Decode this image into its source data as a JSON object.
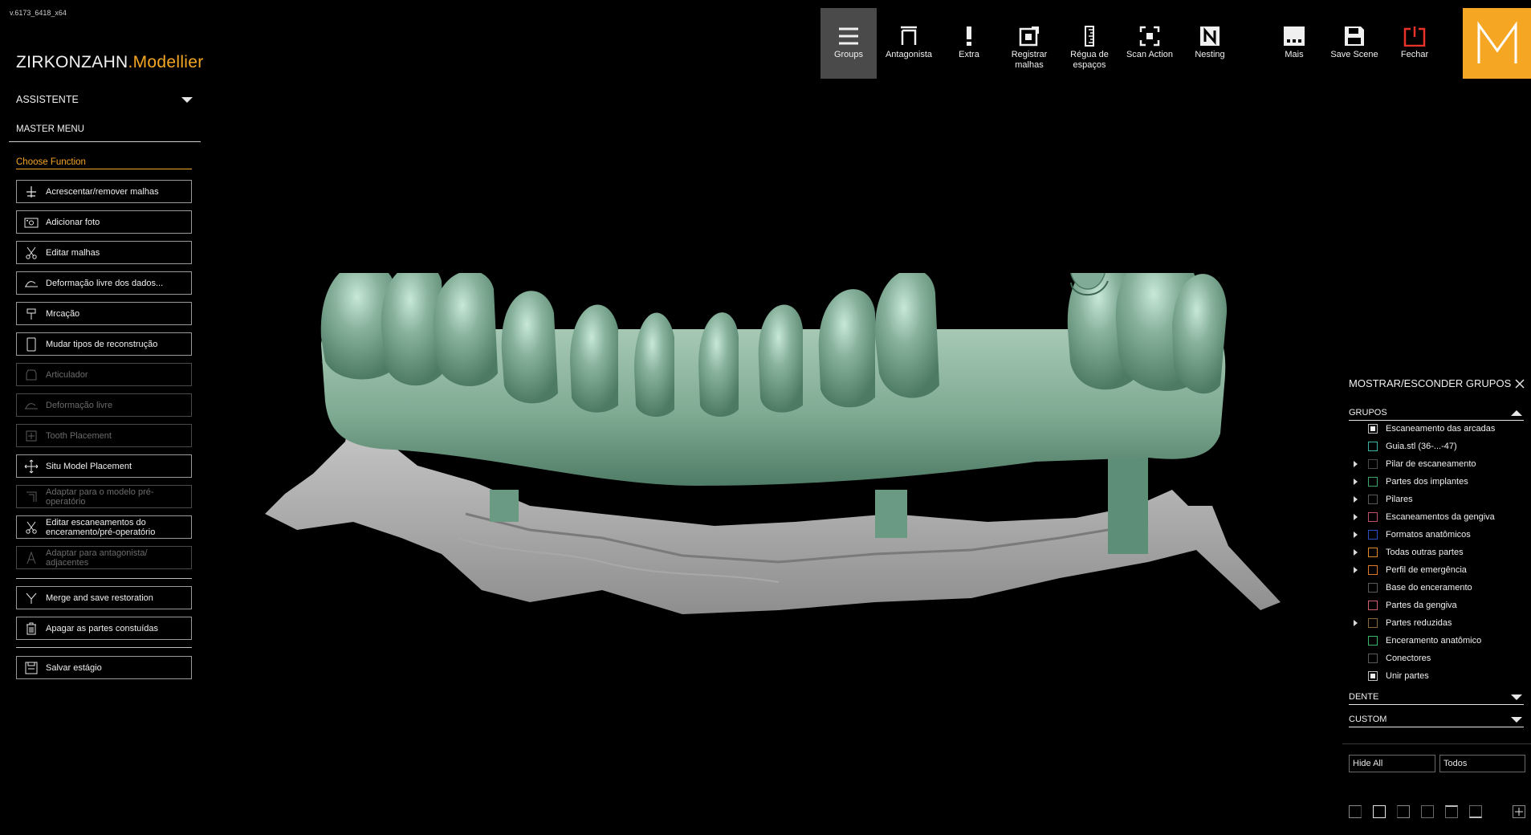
{
  "app": {
    "version": "v.6173_6418_x64",
    "brand_main": "ZIRKONZAHN",
    "brand_accent": ".Modellier",
    "logo_letter": "M",
    "accent_color": "#f5a623"
  },
  "sidebar": {
    "assistant_label": "ASSISTENTE",
    "master_menu_label": "MASTER MENU",
    "choose_function_label": "Choose Function",
    "functions": [
      {
        "label": "Acrescentar/remover malhas",
        "icon": "plus-cross-icon",
        "enabled": true
      },
      {
        "label": "Adicionar foto",
        "icon": "camera-icon",
        "enabled": true
      },
      {
        "label": "Editar malhas",
        "icon": "scissors-icon",
        "enabled": true
      },
      {
        "label": "Deformação livre dos dados...",
        "icon": "deform-icon",
        "enabled": true
      },
      {
        "label": "Mrcação",
        "icon": "pin-icon",
        "enabled": true
      },
      {
        "label": "Mudar tipos de reconstrução",
        "icon": "tooth-icon",
        "enabled": true
      },
      {
        "label": "Articulador",
        "icon": "articulator-icon",
        "enabled": false
      },
      {
        "label": "Deformação livre",
        "icon": "deform-icon",
        "enabled": false
      },
      {
        "label": "Tooth Placement",
        "icon": "tooth-placement-icon",
        "enabled": false
      },
      {
        "label": "Situ Model Placement",
        "icon": "move-arrows-icon",
        "enabled": true
      },
      {
        "label": "Adaptar para o modelo pré-operatório",
        "icon": "adapt-icon",
        "enabled": false
      },
      {
        "label": "Editar escaneamentos do enceramento/pré-operatório",
        "icon": "scissors-icon",
        "enabled": true
      },
      {
        "label": "Adaptar para antagonista/ adjacentes",
        "icon": "letter-a-icon",
        "enabled": false
      }
    ],
    "merge_label": "Merge and save restoration",
    "delete_label": "Apagar as partes constuídas",
    "save_stage_label": "Salvar estágio"
  },
  "toolbar": {
    "buttons": [
      {
        "label": "Groups",
        "icon": "hamburger-icon",
        "active": true
      },
      {
        "label": "Antagonista",
        "icon": "antagonist-icon",
        "active": false
      },
      {
        "label": "Extra",
        "icon": "exclamation-icon",
        "active": false
      },
      {
        "label": "Registrar malhas",
        "icon": "register-meshes-icon",
        "active": false
      },
      {
        "label": "Régua de espaços",
        "icon": "ruler-icon",
        "active": false
      },
      {
        "label": "Scan Action",
        "icon": "scan-frame-icon",
        "active": false
      },
      {
        "label": "Nesting",
        "icon": "nesting-icon",
        "active": false
      },
      {
        "label": "Mais",
        "icon": "more-dots-icon",
        "active": false
      },
      {
        "label": "Save Scene",
        "icon": "floppy-icon",
        "active": false
      },
      {
        "label": "Fechar",
        "icon": "power-icon",
        "active": false
      }
    ]
  },
  "groups_panel": {
    "title": "MOSTRAR/ESCONDER GRUPOS",
    "section_grupos": "GRUPOS",
    "items": [
      {
        "label": "Escaneamento das arcadas",
        "color": "#bdbdbd",
        "checked": true,
        "expandable": false
      },
      {
        "label": "Guia.stl (36-...-47)",
        "color": "#3bb3a6",
        "checked": false,
        "expandable": false
      },
      {
        "label": "Pilar de escaneamento",
        "color": "#4a4a4a",
        "checked": false,
        "expandable": true
      },
      {
        "label": "Partes dos implantes",
        "color": "#3aa86b",
        "checked": false,
        "expandable": true
      },
      {
        "label": "Pilares",
        "color": "#5a5a5a",
        "checked": false,
        "expandable": true
      },
      {
        "label": "Escaneamentos da gengiva",
        "color": "#c0506a",
        "checked": false,
        "expandable": true
      },
      {
        "label": "Formatos anatômicos",
        "color": "#2c4fc2",
        "checked": false,
        "expandable": true
      },
      {
        "label": "Todas outras partes",
        "color": "#e08a2a",
        "checked": false,
        "expandable": true
      },
      {
        "label": "Perfil de emergência",
        "color": "#e07a2a",
        "checked": false,
        "expandable": true
      },
      {
        "label": "Base do enceramento",
        "color": "#5a5a5a",
        "checked": false,
        "expandable": false
      },
      {
        "label": "Partes da gengiva",
        "color": "#d06070",
        "checked": false,
        "expandable": false
      },
      {
        "label": "Partes reduzidas",
        "color": "#8a6a3a",
        "checked": false,
        "expandable": true
      },
      {
        "label": "Enceramento anatômico",
        "color": "#3ab86a",
        "checked": false,
        "expandable": false
      },
      {
        "label": "Conectores",
        "color": "#5a5a5a",
        "checked": false,
        "expandable": false
      },
      {
        "label": "Unir partes",
        "color": "#bdbdbd",
        "checked": true,
        "expandable": false
      }
    ],
    "section_dente": "DENTE",
    "section_custom": "CUSTOM",
    "hide_all_label": "Hide All",
    "todos_label": "Todos"
  }
}
